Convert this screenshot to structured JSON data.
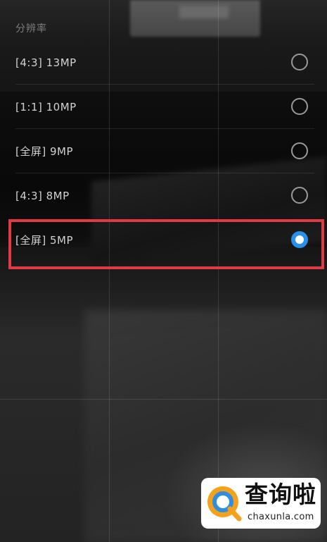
{
  "settings": {
    "section_title": "分辨率",
    "options": [
      {
        "label": "[4:3] 13MP",
        "selected": false
      },
      {
        "label": "[1:1] 10MP",
        "selected": false
      },
      {
        "label": "[全屏] 9MP",
        "selected": false
      },
      {
        "label": "[4:3] 8MP",
        "selected": false
      },
      {
        "label": "[全屏] 5MP",
        "selected": true
      }
    ],
    "highlighted_option": "[全屏] 5MP"
  },
  "colors": {
    "radio_selected": "#2a8fe8",
    "highlight_border": "#e03a44"
  },
  "watermark": {
    "title": "查询啦",
    "url": "chaxunla.com",
    "icon": "magnifier-q-logo"
  }
}
